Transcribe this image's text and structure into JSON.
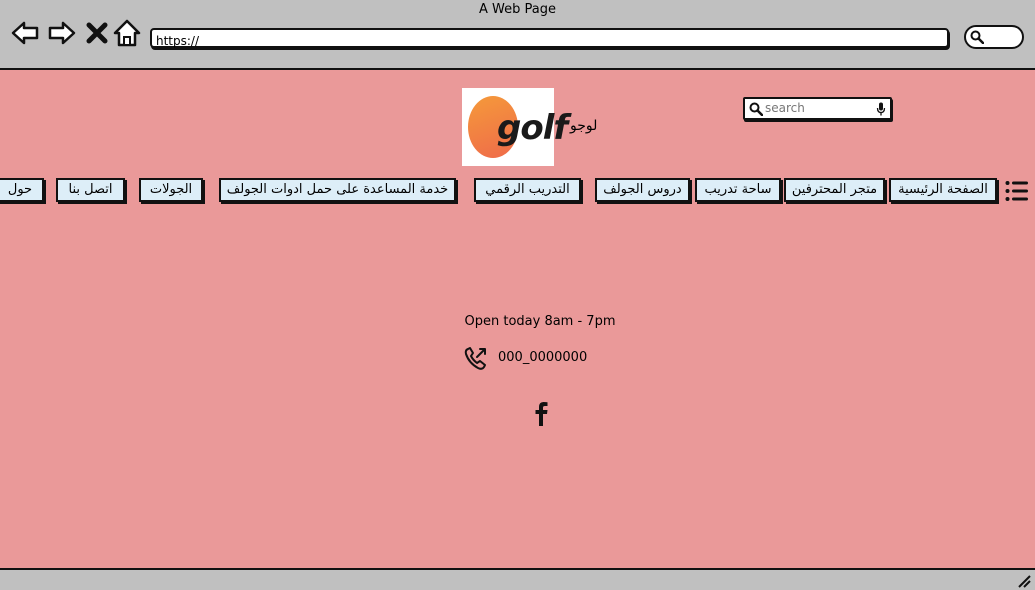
{
  "window": {
    "title": "A Web Page"
  },
  "browser": {
    "url": "https://",
    "icons": [
      "back-arrow-icon",
      "forward-arrow-icon",
      "close-icon",
      "home-icon",
      "search-icon"
    ]
  },
  "header": {
    "logo_text": "golf",
    "logo_label": "لوجو",
    "search": {
      "placeholder": "search"
    }
  },
  "nav": {
    "items": [
      "الصفحة الرئيسية",
      "متجر المحترفين",
      "ساحة تدريب",
      "دروس الجولف",
      "التدريب الرقمي",
      "خدمة المساعدة على حمل ادوات الجولف",
      "الجولات",
      "اتصل بنا",
      "حول"
    ]
  },
  "footer": {
    "hours": "Open today 8am - 7pm",
    "phone": "000_0000000",
    "social": [
      "facebook-icon"
    ]
  },
  "colors": {
    "page_background": "#ea9999",
    "chrome_background": "#c0c0c0",
    "nav_button_background": "#ddeef8",
    "logo_gradient_start": "#f59a3a",
    "logo_gradient_end": "#ef6a4a"
  }
}
